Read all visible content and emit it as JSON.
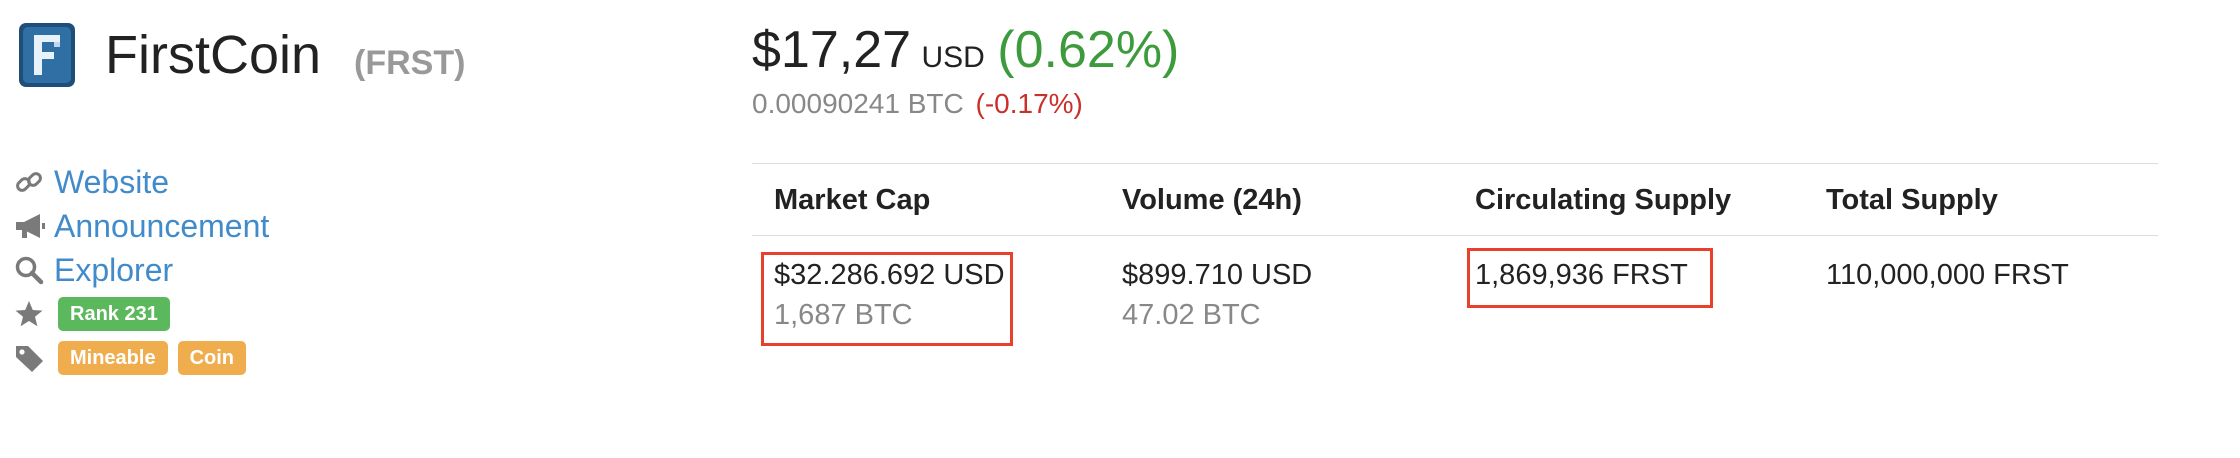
{
  "coin": {
    "name": "FirstCoin",
    "symbol": "(FRST)",
    "logo_icon": "firstcoin-logo"
  },
  "links": [
    {
      "icon": "link-icon",
      "label": "Website"
    },
    {
      "icon": "megaphone-icon",
      "label": "Announcement"
    },
    {
      "icon": "search-icon",
      "label": "Explorer"
    }
  ],
  "rank": {
    "icon": "star-icon",
    "label": "Rank 231"
  },
  "tags": {
    "icon": "tag-icon",
    "items": [
      "Mineable",
      "Coin"
    ]
  },
  "price": {
    "amount": "$17,27",
    "currency": "USD",
    "change": "(0.62%)",
    "btc": "0.00090241 BTC",
    "btc_change": "(-0.17%)"
  },
  "stats": {
    "headers": [
      "Market Cap",
      "Volume (24h)",
      "Circulating Supply",
      "Total Supply"
    ],
    "market_cap": {
      "usd": "$32.286.692 USD",
      "btc": "1,687 BTC"
    },
    "volume": {
      "usd": "$899.710 USD",
      "btc": "47.02 BTC"
    },
    "circulating_supply": "1,869,936 FRST",
    "total_supply": "110,000,000 FRST"
  },
  "colors": {
    "link": "#428bca",
    "positive": "#3d9b3d",
    "negative": "#c9302c",
    "rank_badge": "#5cb85c",
    "tag_badge": "#f0ad4e",
    "highlight": "#e8402a"
  }
}
